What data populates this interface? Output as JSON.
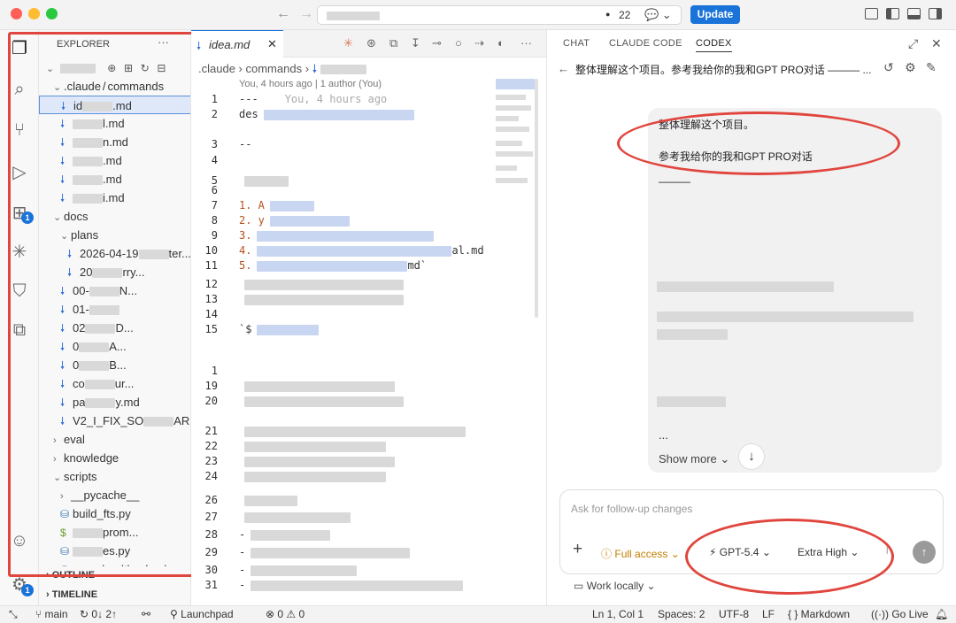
{
  "titlebar": {
    "problems_count": "22",
    "update_label": "Update"
  },
  "activity": {
    "extensions_badge": "1",
    "accounts_badge": "1"
  },
  "explorer": {
    "title": "EXPLORER",
    "more": "···",
    "rows": [
      {
        "label": ".claude",
        "sep": "/",
        "label2": "commands",
        "type": "folder-open",
        "indent": 1
      },
      {
        "label": "id",
        "suffix": ".md",
        "type": "md",
        "indent": 2,
        "selected": true
      },
      {
        "label": "",
        "suffix": "l.md",
        "type": "md",
        "indent": 2
      },
      {
        "label": "",
        "suffix": "n.md",
        "type": "md",
        "indent": 2
      },
      {
        "label": "",
        "suffix": ".md",
        "type": "md",
        "indent": 2
      },
      {
        "label": "",
        "suffix": ".md",
        "type": "md",
        "indent": 2
      },
      {
        "label": "",
        "suffix": "i.md",
        "type": "md",
        "indent": 2
      },
      {
        "label": "docs",
        "type": "folder-open",
        "indent": 1
      },
      {
        "label": "plans",
        "type": "folder-open",
        "indent": 2
      },
      {
        "label": "2026-04-19",
        "suffix": "ter...",
        "type": "md",
        "indent": 3
      },
      {
        "label": "20",
        "suffix": "rry...",
        "type": "md",
        "indent": 3
      },
      {
        "label": "00-",
        "suffix": "N...",
        "type": "md",
        "indent": 2
      },
      {
        "label": "01-",
        "suffix": "",
        "type": "md",
        "indent": 2
      },
      {
        "label": "02",
        "suffix": "D...",
        "type": "md",
        "indent": 2
      },
      {
        "label": "0",
        "suffix": "A...",
        "type": "md",
        "indent": 2
      },
      {
        "label": "0",
        "suffix": "B...",
        "type": "md",
        "indent": 2
      },
      {
        "label": "co",
        "suffix": "ur...",
        "type": "md",
        "indent": 2
      },
      {
        "label": "pa",
        "suffix": "y.md",
        "type": "md",
        "indent": 2
      },
      {
        "label": "V2_I_FIX_SO",
        "suffix": "AR...",
        "type": "md",
        "indent": 2
      },
      {
        "label": "eval",
        "type": "folder-closed",
        "indent": 1
      },
      {
        "label": "knowledge",
        "type": "folder-closed",
        "indent": 1
      },
      {
        "label": "scripts",
        "type": "folder-open",
        "indent": 1
      },
      {
        "label": "__pycache__",
        "type": "folder-closed",
        "indent": 2
      },
      {
        "label": "build_fts.py",
        "type": "py",
        "indent": 2
      },
      {
        "label": "",
        "suffix": "prom...",
        "type": "sh",
        "indent": 2
      },
      {
        "label": "",
        "suffix": "es.py",
        "type": "py",
        "indent": 2
      },
      {
        "label": "repo_health_check",
        "type": "py",
        "indent": 2
      }
    ],
    "outline": "OUTLINE",
    "timeline": "TIMELINE"
  },
  "editor": {
    "tab_label": "idea.md",
    "breadcrumb": [
      ".claude",
      "commands"
    ],
    "blame": "You, 4 hours ago | 1 author (You)",
    "lines": [
      {
        "n": "1",
        "text": "---",
        "ghost": "You, 4 hours ago"
      },
      {
        "n": "2",
        "text": "des"
      },
      {
        "n": "3",
        "text": "--"
      },
      {
        "n": "4",
        "text": ""
      },
      {
        "n": "5",
        "text": ""
      },
      {
        "n": "6",
        "text": ""
      },
      {
        "n": "7",
        "text": "1.   A"
      },
      {
        "n": "8",
        "text": "2.   y"
      },
      {
        "n": "9",
        "text": "3."
      },
      {
        "n": "10",
        "text": "4.",
        "tail": "al.md"
      },
      {
        "n": "11",
        "text": "5.",
        "tail": "md`"
      },
      {
        "n": "12",
        "text": ""
      },
      {
        "n": "13",
        "text": ""
      },
      {
        "n": "14",
        "text": ""
      },
      {
        "n": "15",
        "text": "`$"
      },
      {
        "n": "",
        "text": ""
      },
      {
        "n": "1",
        "text": ""
      },
      {
        "n": "19",
        "text": ""
      },
      {
        "n": "20",
        "text": ""
      },
      {
        "n": "21",
        "text": ""
      },
      {
        "n": "22",
        "text": ""
      },
      {
        "n": "23",
        "text": ""
      },
      {
        "n": "24",
        "text": ""
      },
      {
        "n": "26",
        "text": ""
      },
      {
        "n": "27",
        "text": ""
      },
      {
        "n": "28",
        "text": "-"
      },
      {
        "n": "29",
        "text": "-"
      },
      {
        "n": "30",
        "text": "-"
      },
      {
        "n": "31",
        "text": "-"
      }
    ]
  },
  "codex": {
    "tabs": [
      "CHAT",
      "CLAUDE CODE",
      "CODEX"
    ],
    "thread_title": "整体理解这个项目。参考我给你的我和GPT PRO对话 ——— ...",
    "message_lines": [
      "整体理解这个项目。",
      "参考我给你的我和GPT PRO对话",
      "———"
    ],
    "ellipsis": "...",
    "show_more": "Show more",
    "composer": {
      "placeholder": "Ask for follow-up changes",
      "access": "Full access",
      "model": "GPT-5.4",
      "effort": "Extra High"
    },
    "work_locally": "Work locally"
  },
  "statusbar": {
    "branch": "main",
    "sync": "0↓ 2↑",
    "launchpad": "Launchpad",
    "problems": "⊗ 0 ⚠ 0",
    "position": "Ln 1, Col 1",
    "spaces": "Spaces: 2",
    "encoding": "UTF-8",
    "eol": "LF",
    "language": "{ } Markdown",
    "golive": "Go Live"
  }
}
